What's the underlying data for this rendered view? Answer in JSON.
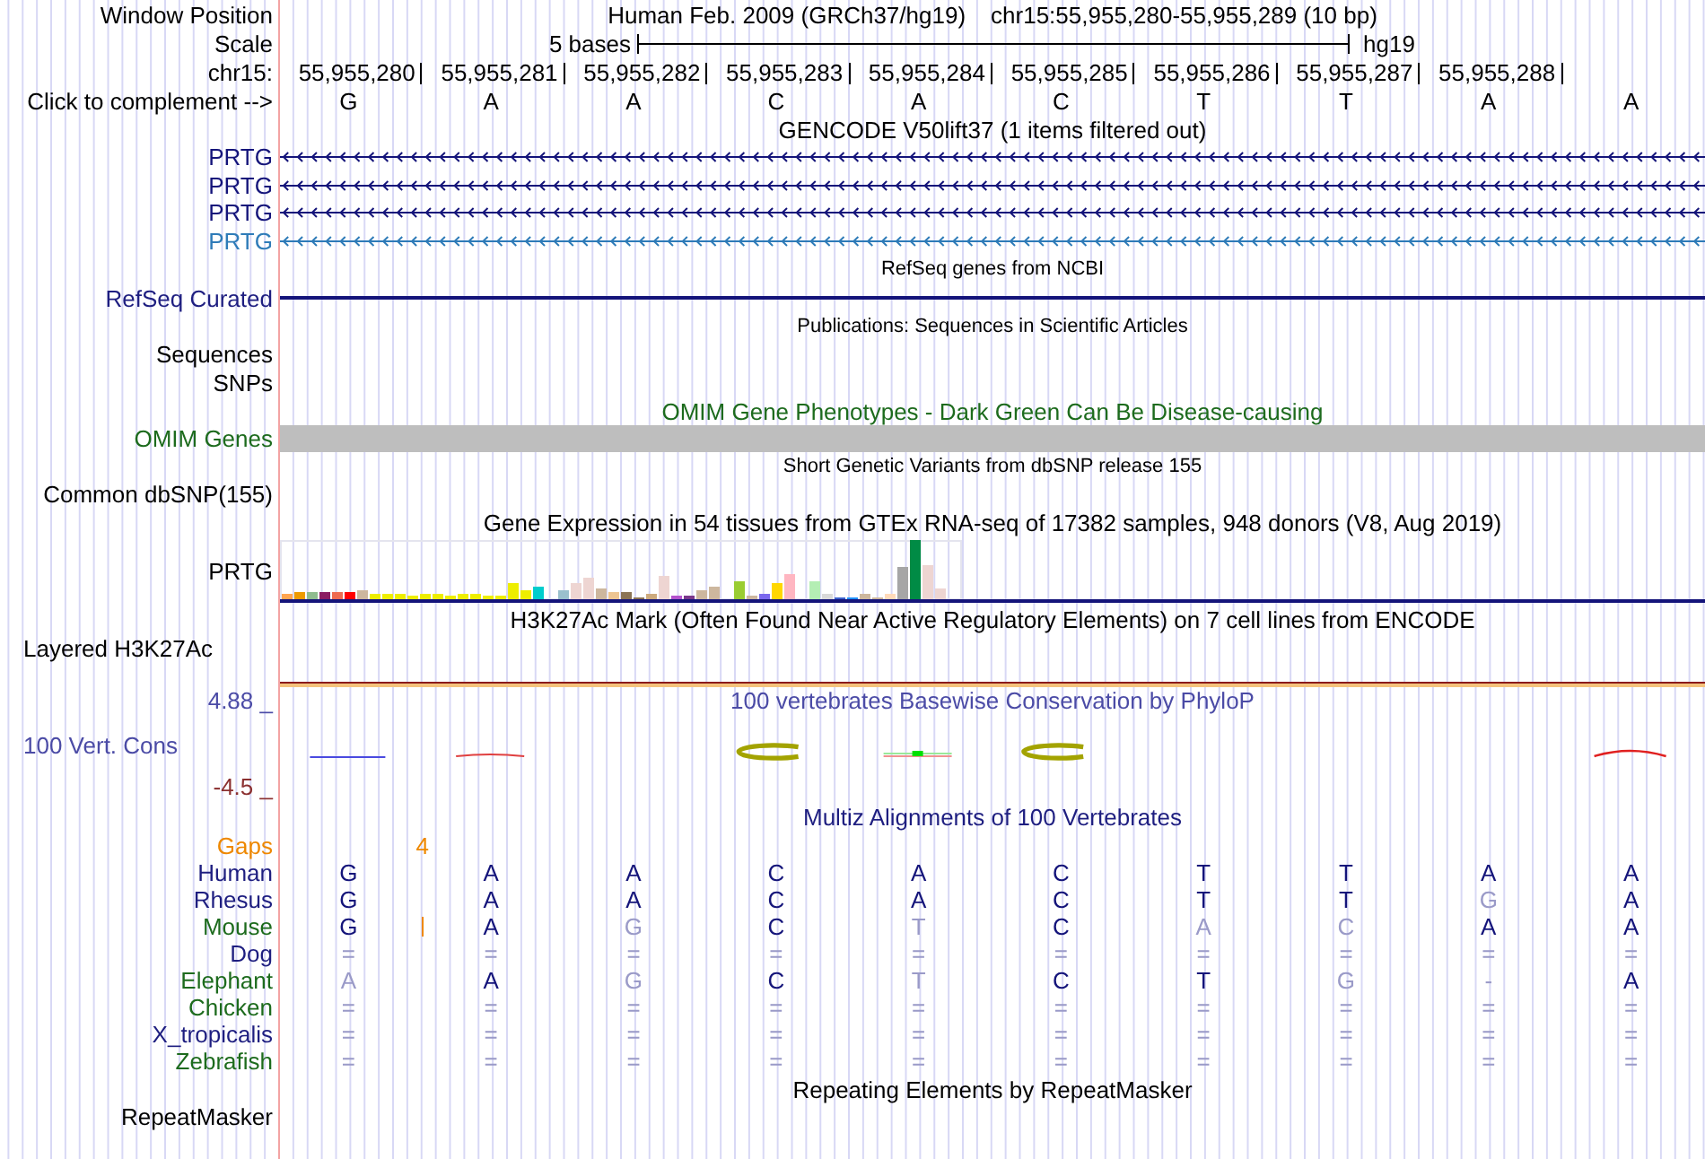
{
  "header": {
    "label": "Window Position",
    "assembly": "Human Feb. 2009 (GRCh37/hg19)",
    "position": "chr15:55,955,280-55,955,289 (10 bp)"
  },
  "scale": {
    "label": "Scale",
    "span": "5 bases",
    "assembly": "hg19"
  },
  "ruler": {
    "label": "chr15:",
    "positions": [
      "55,955,280",
      "55,955,281",
      "55,955,282",
      "55,955,283",
      "55,955,284",
      "55,955,285",
      "55,955,286",
      "55,955,287",
      "55,955,288"
    ]
  },
  "sequence": {
    "label": "Click to complement -->",
    "bases": [
      "G",
      "A",
      "A",
      "C",
      "A",
      "C",
      "T",
      "T",
      "A",
      "A"
    ]
  },
  "tracks": [
    {
      "kind": "genes",
      "title": "GENCODE V50lift37 (1 items filtered out)",
      "genes": [
        {
          "name": "PRTG",
          "color": "#14147a",
          "reverse": true
        },
        {
          "name": "PRTG",
          "color": "#14147a",
          "reverse": true
        },
        {
          "name": "PRTG",
          "color": "#14147a",
          "reverse": true
        },
        {
          "name": "PRTG",
          "color": "#2e7bb8",
          "reverse": true
        }
      ]
    },
    {
      "kind": "refseq",
      "title": "RefSeq genes from NCBI",
      "label": "RefSeq Curated"
    },
    {
      "kind": "publications",
      "title": "Publications: Sequences in Scientific Articles",
      "labels": [
        "Sequences",
        "SNPs"
      ]
    },
    {
      "kind": "omim",
      "title": "OMIM Gene Phenotypes - Dark Green Can Be Disease-causing",
      "label": "OMIM Genes"
    },
    {
      "kind": "variants",
      "title": "Short Genetic Variants from dbSNP release 155",
      "label": "Common dbSNP(155)"
    },
    {
      "kind": "expression",
      "title": "Gene Expression in 54 tissues from GTEx RNA-seq of 17382 samples, 948 donors (V8, Aug 2019)",
      "label": "PRTG"
    },
    {
      "kind": "layered",
      "title": "H3K27Ac Mark (Often Found Near Active Regulatory Elements) on 7 cell lines from ENCODE",
      "label": "Layered H3K27Ac"
    },
    {
      "kind": "conservation",
      "title": "100 vertebrates Basewise Conservation by PhyloP",
      "label": "100 Vert. Cons",
      "ymax": "4.88 _",
      "ymin": "-4.5 _"
    },
    {
      "kind": "alignment",
      "title": "Multiz Alignments of 100 Vertebrates",
      "gaps": {
        "label": "Gaps",
        "count": "4"
      },
      "species": [
        {
          "name": "Human",
          "color": "#1e1e80",
          "insertion": false,
          "bases": [
            {
              "base": "G",
              "match": true
            },
            {
              "base": "A",
              "match": true
            },
            {
              "base": "A",
              "match": true
            },
            {
              "base": "C",
              "match": true
            },
            {
              "base": "A",
              "match": true
            },
            {
              "base": "C",
              "match": true
            },
            {
              "base": "T",
              "match": true
            },
            {
              "base": "T",
              "match": true
            },
            {
              "base": "A",
              "match": true
            },
            {
              "base": "A",
              "match": true
            }
          ]
        },
        {
          "name": "Rhesus",
          "color": "#1e1e80",
          "insertion": false,
          "bases": [
            {
              "base": "G",
              "match": true
            },
            {
              "base": "A",
              "match": true
            },
            {
              "base": "A",
              "match": true
            },
            {
              "base": "C",
              "match": true
            },
            {
              "base": "A",
              "match": true
            },
            {
              "base": "C",
              "match": true
            },
            {
              "base": "T",
              "match": true
            },
            {
              "base": "T",
              "match": true
            },
            {
              "base": "G",
              "match": false
            },
            {
              "base": "A",
              "match": true
            }
          ]
        },
        {
          "name": "Mouse",
          "color": "#1d6b1d",
          "insertion": true,
          "bases": [
            {
              "base": "G",
              "match": true
            },
            {
              "base": "A",
              "match": true
            },
            {
              "base": "G",
              "match": false
            },
            {
              "base": "C",
              "match": true
            },
            {
              "base": "T",
              "match": false
            },
            {
              "base": "C",
              "match": true
            },
            {
              "base": "A",
              "match": false
            },
            {
              "base": "C",
              "match": false
            },
            {
              "base": "A",
              "match": true
            },
            {
              "base": "A",
              "match": true
            }
          ]
        },
        {
          "name": "Dog",
          "color": "#1e1e80",
          "insertion": false,
          "bases": [
            {
              "base": "=",
              "match": false
            },
            {
              "base": "=",
              "match": false
            },
            {
              "base": "=",
              "match": false
            },
            {
              "base": "=",
              "match": false
            },
            {
              "base": "=",
              "match": false
            },
            {
              "base": "=",
              "match": false
            },
            {
              "base": "=",
              "match": false
            },
            {
              "base": "=",
              "match": false
            },
            {
              "base": "=",
              "match": false
            },
            {
              "base": "=",
              "match": false
            }
          ]
        },
        {
          "name": "Elephant",
          "color": "#1d6b1d",
          "insertion": false,
          "bases": [
            {
              "base": "A",
              "match": false
            },
            {
              "base": "A",
              "match": true
            },
            {
              "base": "G",
              "match": false
            },
            {
              "base": "C",
              "match": true
            },
            {
              "base": "T",
              "match": false
            },
            {
              "base": "C",
              "match": true
            },
            {
              "base": "T",
              "match": true
            },
            {
              "base": "G",
              "match": false
            },
            {
              "base": "-",
              "match": false
            },
            {
              "base": "A",
              "match": true
            }
          ]
        },
        {
          "name": "Chicken",
          "color": "#1d6b1d",
          "insertion": false,
          "bases": [
            {
              "base": "=",
              "match": false
            },
            {
              "base": "=",
              "match": false
            },
            {
              "base": "=",
              "match": false
            },
            {
              "base": "=",
              "match": false
            },
            {
              "base": "=",
              "match": false
            },
            {
              "base": "=",
              "match": false
            },
            {
              "base": "=",
              "match": false
            },
            {
              "base": "=",
              "match": false
            },
            {
              "base": "=",
              "match": false
            },
            {
              "base": "=",
              "match": false
            }
          ]
        },
        {
          "name": "X_tropicalis",
          "color": "#1e1e80",
          "insertion": false,
          "bases": [
            {
              "base": "=",
              "match": false
            },
            {
              "base": "=",
              "match": false
            },
            {
              "base": "=",
              "match": false
            },
            {
              "base": "=",
              "match": false
            },
            {
              "base": "=",
              "match": false
            },
            {
              "base": "=",
              "match": false
            },
            {
              "base": "=",
              "match": false
            },
            {
              "base": "=",
              "match": false
            },
            {
              "base": "=",
              "match": false
            },
            {
              "base": "=",
              "match": false
            }
          ]
        },
        {
          "name": "Zebrafish",
          "color": "#1d6b1d",
          "insertion": false,
          "bases": [
            {
              "base": "=",
              "match": false
            },
            {
              "base": "=",
              "match": false
            },
            {
              "base": "=",
              "match": false
            },
            {
              "base": "=",
              "match": false
            },
            {
              "base": "=",
              "match": false
            },
            {
              "base": "=",
              "match": false
            },
            {
              "base": "=",
              "match": false
            },
            {
              "base": "=",
              "match": false
            },
            {
              "base": "=",
              "match": false
            },
            {
              "base": "=",
              "match": false
            }
          ]
        }
      ]
    },
    {
      "kind": "repeats",
      "title": "Repeating Elements by RepeatMasker",
      "label": "RepeatMasker"
    }
  ]
}
